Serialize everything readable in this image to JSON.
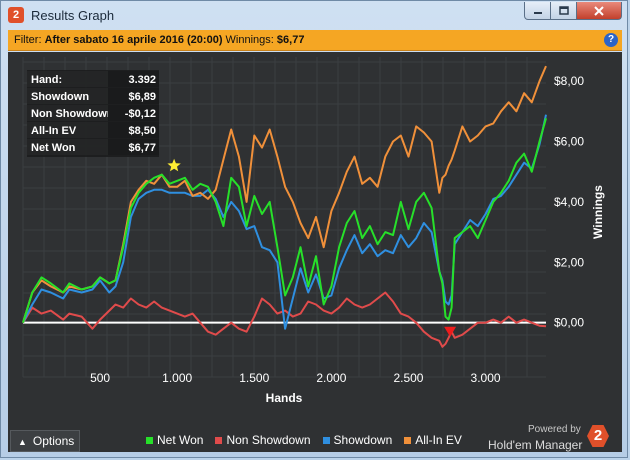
{
  "window": {
    "title": "Results Graph",
    "app_icon": "2",
    "controls": {
      "minimize": "minimize-icon",
      "maximize": "maximize-icon",
      "close": "close-icon"
    }
  },
  "filter": {
    "label": "Filter:",
    "value": "After sabato 16 aprile 2016 (20:00)",
    "winnings_label": "Winnings:",
    "winnings_value": "$6,77",
    "help": "?"
  },
  "stats": [
    {
      "label": "Hand:",
      "value": "3.392"
    },
    {
      "label": "Showdown",
      "value": "$6,89"
    },
    {
      "label": "Non Showdown",
      "value": "-$0,12"
    },
    {
      "label": "All-In EV",
      "value": "$8,50"
    },
    {
      "label": "Net Won",
      "value": "$6,77"
    }
  ],
  "colors": {
    "net_won": "#27e02a",
    "non_showdown": "#e04b4b",
    "showdown": "#2f8fe0",
    "all_in_ev": "#f0903a",
    "zero_line": "#ffffff",
    "background": "#2f3133"
  },
  "chart_data": {
    "type": "line",
    "xlabel": "Hands",
    "ylabel": "Winnings",
    "xlim": [
      0,
      3392
    ],
    "ylim": [
      -1.8,
      8.8
    ],
    "grid": true,
    "legend_placement": "bottom",
    "x_tick_values": [
      500,
      1000,
      1500,
      2000,
      2500,
      3000
    ],
    "x_tick_labels": [
      "500",
      "1.000",
      "1.500",
      "2.000",
      "2.500",
      "3.000"
    ],
    "y_tick_values": [
      0,
      2,
      4,
      6,
      8
    ],
    "y_tick_labels": [
      "$0,00",
      "$2,00",
      "$4,00",
      "$6,00",
      "$8,00"
    ],
    "series": [
      {
        "name": "Net Won",
        "x": [
          0,
          60,
          120,
          180,
          260,
          300,
          380,
          450,
          500,
          560,
          600,
          650,
          700,
          750,
          800,
          850,
          900,
          950,
          1000,
          1050,
          1100,
          1150,
          1200,
          1250,
          1300,
          1350,
          1400,
          1450,
          1500,
          1550,
          1600,
          1650,
          1700,
          1750,
          1800,
          1850,
          1900,
          1950,
          2000,
          2050,
          2100,
          2150,
          2200,
          2250,
          2300,
          2350,
          2400,
          2450,
          2500,
          2550,
          2600,
          2650,
          2700,
          2720,
          2740,
          2760,
          2780,
          2800,
          2850,
          2900,
          2950,
          3000,
          3050,
          3100,
          3150,
          3200,
          3250,
          3300,
          3350,
          3392
        ],
        "y": [
          0,
          1,
          1.5,
          1.3,
          1.0,
          1.3,
          1.1,
          1.2,
          1.5,
          1.3,
          1.4,
          2.5,
          3.8,
          4.3,
          4.6,
          4.8,
          4.9,
          4.6,
          4.7,
          4.8,
          4.4,
          4.6,
          4.5,
          4.0,
          3.2,
          4.8,
          4.5,
          3.2,
          4.2,
          3.6,
          4.0,
          2.5,
          0.9,
          1.5,
          2.5,
          1.2,
          2.2,
          0.6,
          1.2,
          2.5,
          3.3,
          3.7,
          2.8,
          3.2,
          2.6,
          3.0,
          2.9,
          4.0,
          3.1,
          4.0,
          4.3,
          3.8,
          1.7,
          1.3,
          0.2,
          0.1,
          0.5,
          2.8,
          3.0,
          3.2,
          2.8,
          3.4,
          4.0,
          4.3,
          4.7,
          5.3,
          5.6,
          5.0,
          6.0,
          6.77
        ]
      },
      {
        "name": "Non Showdown",
        "x": [
          0,
          60,
          120,
          180,
          260,
          300,
          380,
          450,
          500,
          560,
          600,
          650,
          700,
          750,
          800,
          850,
          900,
          950,
          1000,
          1050,
          1100,
          1150,
          1200,
          1250,
          1300,
          1350,
          1400,
          1450,
          1500,
          1550,
          1600,
          1650,
          1700,
          1750,
          1800,
          1850,
          1900,
          1950,
          2000,
          2050,
          2100,
          2150,
          2200,
          2250,
          2300,
          2350,
          2400,
          2450,
          2500,
          2550,
          2600,
          2650,
          2700,
          2720,
          2740,
          2760,
          2780,
          2800,
          2850,
          2900,
          2950,
          3000,
          3050,
          3100,
          3150,
          3200,
          3250,
          3300,
          3350,
          3392
        ],
        "y": [
          0,
          0.5,
          0.3,
          0.4,
          0.1,
          0.3,
          0.2,
          -0.2,
          0.1,
          0.4,
          0.6,
          0.5,
          0.8,
          0.6,
          0.5,
          0.7,
          0.5,
          0.4,
          0.3,
          0.2,
          0.3,
          0.0,
          -0.3,
          -0.4,
          -0.2,
          0.0,
          -0.2,
          -0.3,
          0.2,
          0.8,
          0.6,
          0.3,
          0.4,
          0.2,
          0.3,
          0.7,
          0.6,
          0.4,
          0.3,
          0.5,
          0.8,
          0.6,
          0.5,
          0.6,
          0.8,
          1.0,
          0.7,
          0.3,
          0.2,
          0.0,
          -0.3,
          -0.5,
          -0.6,
          -0.8,
          -0.7,
          -0.5,
          -0.3,
          -0.5,
          -0.4,
          -0.2,
          0.0,
          0.0,
          0.1,
          0.0,
          0.2,
          0.0,
          0.1,
          0.0,
          -0.1,
          -0.12
        ]
      },
      {
        "name": "Showdown",
        "x": [
          0,
          60,
          120,
          180,
          260,
          300,
          380,
          450,
          500,
          560,
          600,
          650,
          700,
          750,
          800,
          850,
          900,
          950,
          1000,
          1050,
          1100,
          1150,
          1200,
          1250,
          1300,
          1350,
          1400,
          1450,
          1500,
          1550,
          1600,
          1650,
          1700,
          1750,
          1800,
          1850,
          1900,
          1950,
          2000,
          2050,
          2100,
          2150,
          2200,
          2250,
          2300,
          2350,
          2400,
          2450,
          2500,
          2550,
          2600,
          2650,
          2700,
          2720,
          2740,
          2760,
          2780,
          2800,
          2850,
          2900,
          2950,
          3000,
          3050,
          3100,
          3150,
          3200,
          3250,
          3300,
          3350,
          3392
        ],
        "y": [
          0,
          0.6,
          1.1,
          1.0,
          0.8,
          1.1,
          1.0,
          1.1,
          1.4,
          1.0,
          1.2,
          2.0,
          3.5,
          4.1,
          4.3,
          4.4,
          4.4,
          4.3,
          4.3,
          4.3,
          4.2,
          4.2,
          4.4,
          4.1,
          3.5,
          4.0,
          3.7,
          3.1,
          3.2,
          2.5,
          2.4,
          2.0,
          -0.2,
          0.8,
          1.8,
          1.0,
          1.6,
          0.8,
          0.9,
          1.8,
          2.4,
          2.9,
          2.3,
          2.6,
          2.2,
          2.4,
          2.3,
          2.9,
          2.5,
          2.8,
          3.3,
          3.0,
          1.7,
          1.4,
          0.7,
          0.6,
          0.9,
          2.6,
          3.0,
          3.4,
          3.2,
          3.6,
          4.1,
          4.2,
          4.5,
          4.9,
          5.3,
          5.1,
          5.9,
          6.89
        ]
      },
      {
        "name": "All-In EV",
        "x": [
          0,
          60,
          120,
          180,
          260,
          300,
          380,
          450,
          500,
          560,
          600,
          650,
          700,
          750,
          800,
          850,
          900,
          950,
          1000,
          1050,
          1100,
          1150,
          1200,
          1250,
          1300,
          1350,
          1400,
          1450,
          1500,
          1550,
          1600,
          1650,
          1700,
          1750,
          1800,
          1850,
          1900,
          1950,
          2000,
          2050,
          2100,
          2150,
          2200,
          2250,
          2300,
          2350,
          2400,
          2450,
          2500,
          2550,
          2600,
          2650,
          2700,
          2720,
          2740,
          2760,
          2780,
          2800,
          2850,
          2900,
          2950,
          3000,
          3050,
          3100,
          3150,
          3200,
          3250,
          3300,
          3350,
          3392
        ],
        "y": [
          0,
          1.0,
          1.4,
          1.2,
          1.0,
          1.2,
          1.1,
          1.2,
          1.5,
          1.3,
          1.4,
          2.6,
          4.0,
          4.4,
          4.7,
          4.6,
          4.9,
          4.5,
          4.5,
          4.7,
          4.2,
          4.3,
          4.1,
          4.4,
          5.4,
          6.4,
          5.5,
          4.0,
          6.2,
          5.8,
          6.4,
          5.5,
          4.5,
          4.0,
          3.3,
          2.8,
          3.5,
          2.5,
          3.7,
          4.3,
          5.0,
          5.5,
          4.6,
          4.8,
          4.5,
          5.5,
          6.0,
          6.2,
          5.5,
          6.5,
          6.3,
          6.0,
          4.3,
          4.8,
          4.9,
          5.2,
          5.4,
          5.7,
          6.5,
          6.0,
          6.2,
          6.5,
          6.6,
          7.0,
          7.3,
          7.0,
          7.6,
          7.3,
          8.0,
          8.5
        ]
      }
    ],
    "markers": [
      {
        "name": "star",
        "x": 980,
        "y": 5.2,
        "color": "#ffee33"
      },
      {
        "name": "triangle-down",
        "x": 2770,
        "y": -0.3,
        "color": "#ee1c1c"
      }
    ]
  },
  "legend": [
    "Net Won",
    "Non Showdown",
    "Showdown",
    "All-In EV"
  ],
  "footer": {
    "options_label": "Options",
    "powered_by": "Powered by",
    "brand": "Hold'em Manager",
    "brand_logo": "2"
  }
}
